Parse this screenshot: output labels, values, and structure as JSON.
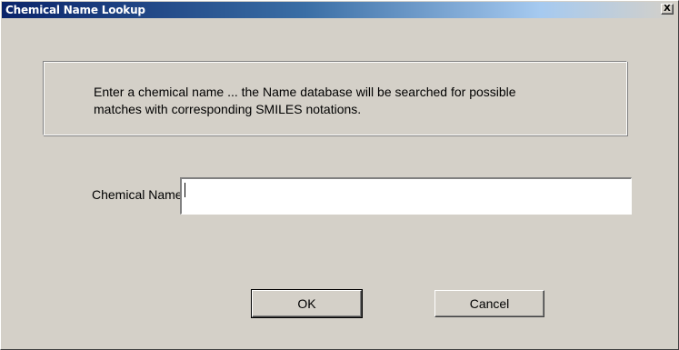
{
  "window": {
    "title": "Chemical Name Lookup",
    "close_label": "X"
  },
  "info": {
    "message_line1": "Enter a chemical name ... the Name database will be searched for possible",
    "message_line2": "matches with corresponding SMILES notations."
  },
  "form": {
    "name_label": "Chemical Name:",
    "name_value": "",
    "name_placeholder": ""
  },
  "buttons": {
    "ok_label": "OK",
    "cancel_label": "Cancel"
  },
  "colors": {
    "dialog_bg": "#d4d0c8",
    "titlebar_start": "#0a246a",
    "titlebar_end": "#d4d0c8"
  }
}
